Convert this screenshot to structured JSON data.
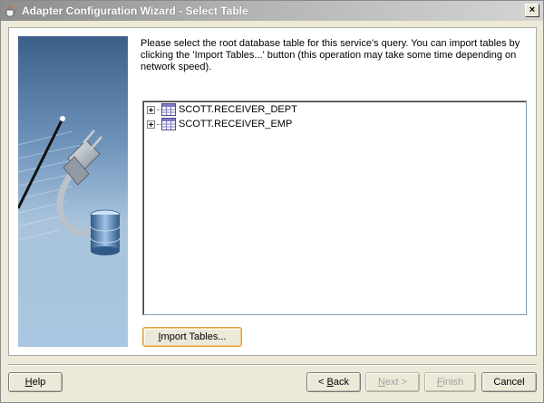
{
  "window": {
    "title": "Adapter Configuration Wizard - Select Table",
    "close_label": "×"
  },
  "instructions": {
    "text": "Please select the root database table for this service's query.  You can import tables by clicking the 'Import Tables...' button (this operation may take some time depending on network speed)."
  },
  "tree": {
    "items": [
      {
        "label": "SCOTT.RECEIVER_DEPT",
        "icon": "table-icon",
        "expanded": false
      },
      {
        "label": "SCOTT.RECEIVER_EMP",
        "icon": "table-icon",
        "expanded": false
      }
    ]
  },
  "buttons": {
    "import_mnemonic": "I",
    "import_rest": "mport Tables...",
    "help_mnemonic": "H",
    "help_rest": "elp",
    "back_prefix": "< ",
    "back_mnemonic": "B",
    "back_rest": "ack",
    "next_mnemonic": "N",
    "next_rest": "ext >",
    "finish_mnemonic": "F",
    "finish_rest": "inish",
    "cancel_label": "Cancel"
  },
  "colors": {
    "titlebar_start": "#8d8d8d",
    "titlebar_end": "#d4d4d4",
    "dialog_bg": "#ece9d8",
    "panel_bg": "#ffffff",
    "focus_border": "#e0a040"
  }
}
